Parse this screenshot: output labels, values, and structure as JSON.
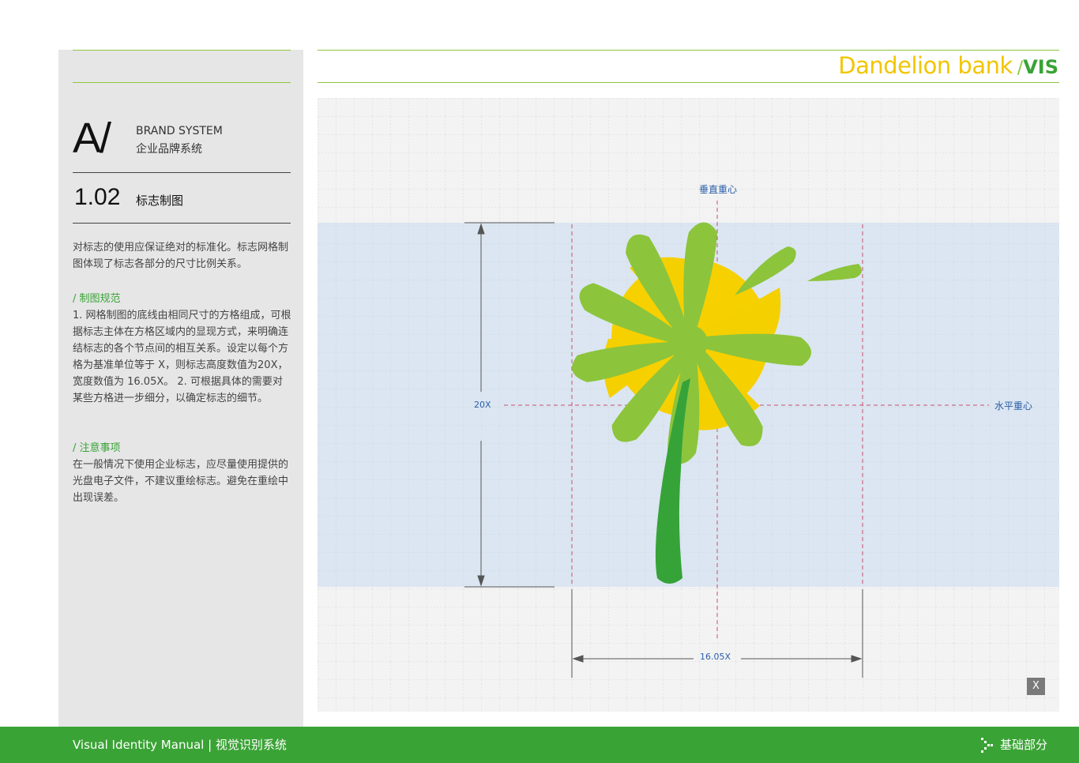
{
  "header": {
    "brand_name": "Dandelion bank",
    "separator": "/",
    "brand_suffix": "VIS"
  },
  "sidebar": {
    "section_letter": "A/",
    "section_en": "BRAND SYSTEM",
    "section_cn": "企业品牌系统",
    "page_number": "1.02",
    "page_title": "标志制图",
    "intro": "对标志的使用应保证绝对的标准化。标志网格制图体现了标志各部分的尺寸比例关系。",
    "rules_heading": "/ 制图规范",
    "rules_body": "1. 网格制图的底线由相同尺寸的方格组成，可根据标志主体在方格区域内的显现方式，来明确连结标志的各个节点间的相互关系。设定以每个方格为基准单位等于 X，则标志高度数值为20X，宽度数值为 16.05X。 2. 可根据具体的需要对某些方格进一步细分，以确定标志的细节。",
    "notes_heading": "/ 注意事项",
    "notes_body": "在一般情况下使用企业标志，应尽量使用提供的光盘电子文件，不建议重绘标志。避免在重绘中出现误差。"
  },
  "diagram": {
    "vertical_center_label": "垂直重心",
    "horizontal_center_label": "水平重心",
    "height_label": "20X",
    "width_label": "16.05X"
  },
  "close_button": "X",
  "footer": {
    "left_text": "Visual Identity Manual | 视觉识别系统",
    "right_text": "基础部分"
  },
  "colors": {
    "brand_green": "#3aa335",
    "light_green": "#8dc63f",
    "brand_yellow": "#f2c500",
    "band_blue": "#dbe6f2",
    "guide_red": "#c8506a",
    "label_blue": "#2a5ea8"
  }
}
